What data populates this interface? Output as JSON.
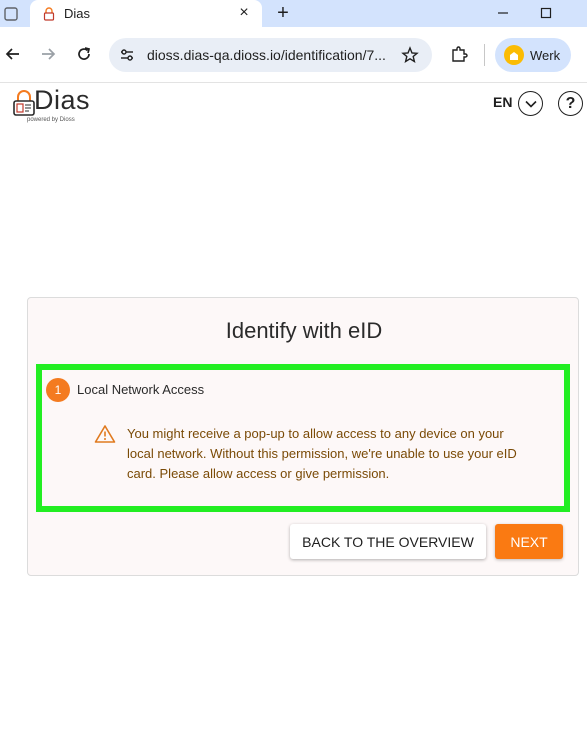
{
  "browser": {
    "tab_title": "Dias",
    "tab_close": "×",
    "new_tab": "+",
    "url": "dioss.dias-qa.dioss.io/identification/7...",
    "profile_label": "Werk"
  },
  "header": {
    "logo_text": "Dias",
    "logo_subtext": "powered by Dioss",
    "language": "EN",
    "help": "?"
  },
  "card": {
    "title": "Identify with eID",
    "step": {
      "number": "1",
      "title": "Local Network Access",
      "warning": "You might receive a pop-up to allow access to any device on your local network. Without this permission, we're unable to use your eID card. Please allow access or give permission."
    },
    "back_label": "BACK TO THE OVERVIEW",
    "next_label": "NEXT"
  },
  "colors": {
    "accent": "#fa7a12",
    "highlight": "#22ee22",
    "warning_text": "#7a4a06",
    "tabstrip": "#d3e3fd"
  }
}
